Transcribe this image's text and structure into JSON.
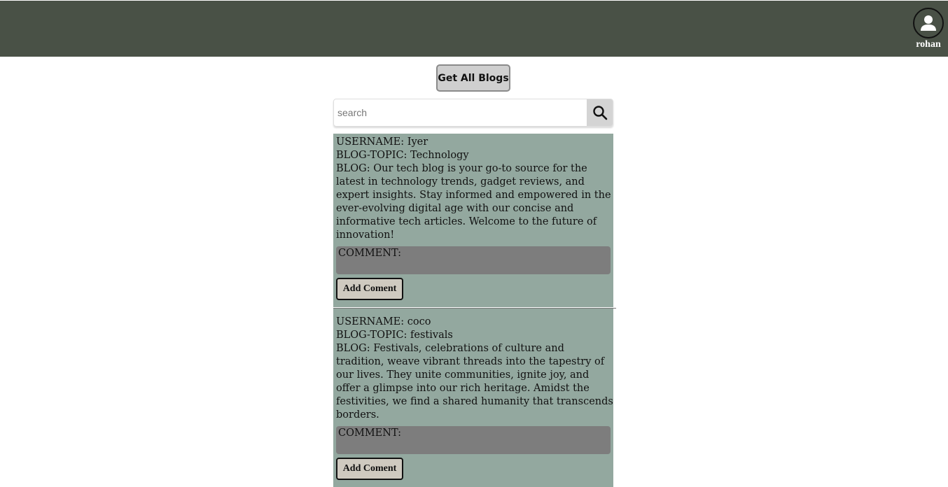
{
  "header": {
    "user": {
      "icon": "user-avatar-icon",
      "name": "rohan"
    }
  },
  "toolbar": {
    "get_all_label": "Get All Blogs"
  },
  "search": {
    "placeholder": "search",
    "value": "",
    "icon": "search-icon"
  },
  "blogs": [
    {
      "username_line": "USERNAME: Iyer",
      "topic_line": "BLOG-TOPIC: Technology",
      "blog_line": "BLOG: Our tech blog is your go-to source for the latest in technology trends, gadget reviews, and expert insights. Stay informed and empowered in the ever-evolving digital age with our concise and informative tech articles. Welcome to the future of innovation!",
      "comment_label": "COMMENT:",
      "add_comment_label": "Add Coment"
    },
    {
      "username_line": "USERNAME: coco",
      "topic_line": "BLOG-TOPIC: festivals",
      "blog_line": "BLOG: Festivals, celebrations of culture and tradition, weave vibrant threads into the tapestry of our lives. They unite communities, ignite joy, and offer a glimpse into our rich heritage. Amidst the festivities, we find a shared humanity that transcends borders.",
      "comment_label": "COMMENT:",
      "add_comment_label": "Add Coment"
    }
  ],
  "colors": {
    "header_bg": "#495146",
    "card_bg": "#93a89f",
    "comment_bg": "#7d7d7d"
  }
}
